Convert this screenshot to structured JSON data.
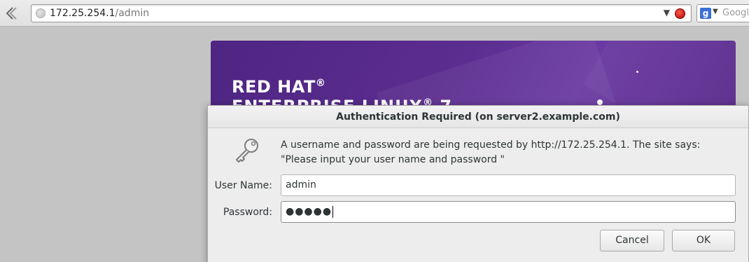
{
  "browser": {
    "url_host": "172.25.254.1",
    "url_path": "/admin",
    "search_placeholder": "Google",
    "url_dropdown_icon": "chevron-down-icon",
    "stop_icon": "stop-icon"
  },
  "page": {
    "brand_line1": "RED HAT",
    "brand_line2": "ENTERPRISE LINUX",
    "brand_version": "7",
    "trademark": "®",
    "banner_color": "#5b2d8f"
  },
  "dialog": {
    "title": "Authentication Required (on server2.example.com)",
    "message": "A username and password are being requested by http://172.25.254.1. The site says: \"Please input your user name and password \"",
    "username_label": "User Name:",
    "username_value": "admin",
    "password_label": "Password:",
    "password_masked": "●●●●●",
    "cancel_label": "Cancel",
    "ok_label": "OK"
  }
}
